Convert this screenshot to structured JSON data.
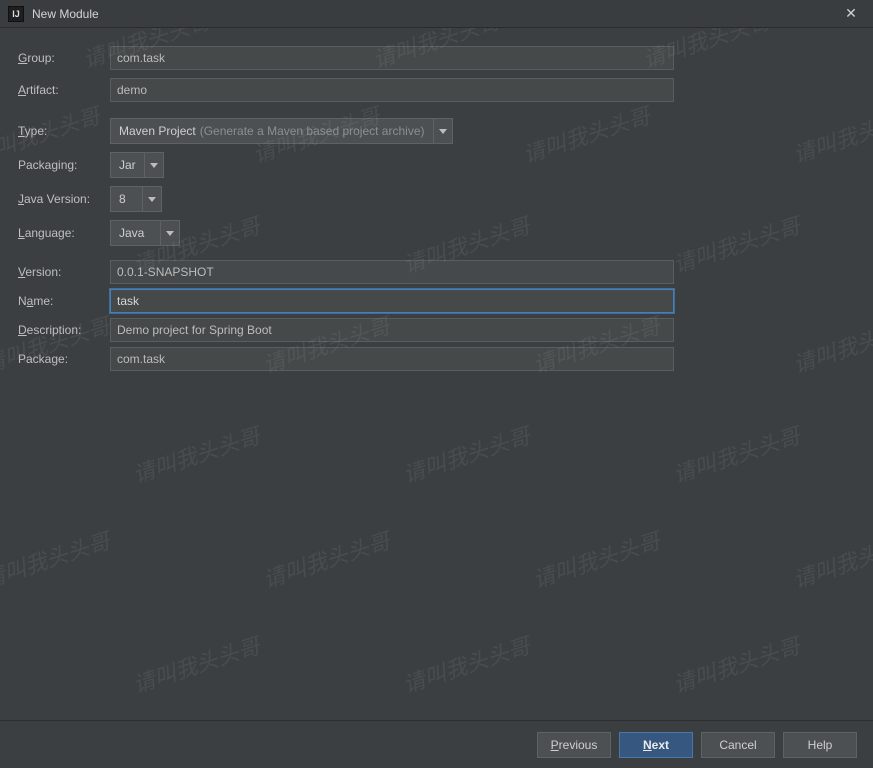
{
  "window": {
    "title": "New Module"
  },
  "labels": {
    "group": "Group:",
    "group_ul": "G",
    "artifact": "Artifact:",
    "artifact_ul": "A",
    "type": "Type:",
    "type_ul": "T",
    "packaging": "Packaging:",
    "packaging_ul": "",
    "java": "Java Version:",
    "java_ul": "J",
    "language": "Language:",
    "language_ul": "L",
    "version": "Version:",
    "version_ul": "V",
    "name": "Name:",
    "name_ul": "N",
    "description": "Description:",
    "description_ul": "D",
    "package": "Package:",
    "package_ul": "P"
  },
  "fields": {
    "group": "com.task",
    "artifact": "demo",
    "type_main": "Maven Project",
    "type_hint": "(Generate a Maven based project archive)",
    "packaging": "Jar",
    "java_version": "8",
    "language": "Java",
    "version": "0.0.1-SNAPSHOT",
    "name": "task",
    "description": "Demo project for Spring Boot",
    "package": "com.task"
  },
  "buttons": {
    "previous": "Previous",
    "previous_ul": "P",
    "next": "Next",
    "next_ul": "N",
    "cancel": "Cancel",
    "help": "Help"
  },
  "watermark": "请叫我头头哥",
  "icon_label": "IJ"
}
